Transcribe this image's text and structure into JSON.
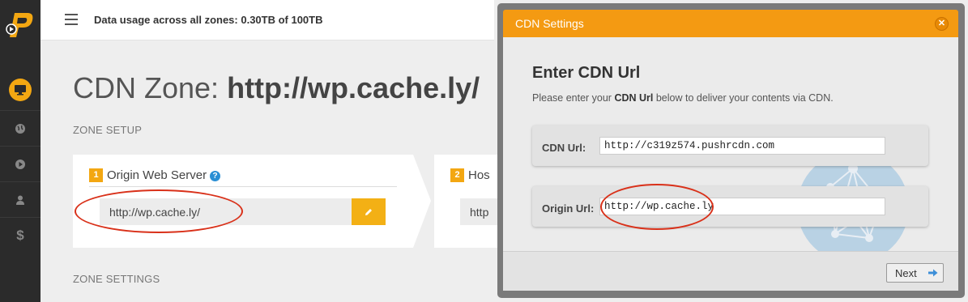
{
  "topbar": {
    "usage_text": "Data usage across all zones: 0.30TB of 100TB"
  },
  "page": {
    "title_prefix": "CDN Zone:",
    "title_zone": "http://wp.cache.ly/",
    "zone_setup_label": "ZONE SETUP",
    "zone_settings_label": "ZONE SETTINGS"
  },
  "steps": [
    {
      "number": "1",
      "title": "Origin Web Server",
      "value": "http://wp.cache.ly/"
    },
    {
      "number": "2",
      "title": "Hos",
      "value": "http"
    }
  ],
  "sidebar": {
    "items": [
      "monitor-icon",
      "globe-icon",
      "play-icon",
      "user-icon",
      "dollar-icon"
    ],
    "accent_color": "#f3a712"
  },
  "dialog": {
    "title": "CDN Settings",
    "heading": "Enter CDN Url",
    "desc_prefix": "Please enter your ",
    "desc_bold": "CDN Url",
    "desc_suffix": " below to deliver your contents via CDN.",
    "cdn_url_label": "CDN Url:",
    "cdn_url_value": "http://c319z574.pushrcdn.com",
    "origin_url_label": "Origin Url:",
    "origin_url_value": "http://wp.cache.ly",
    "next_label": "Next",
    "header_color": "#f49a12"
  }
}
